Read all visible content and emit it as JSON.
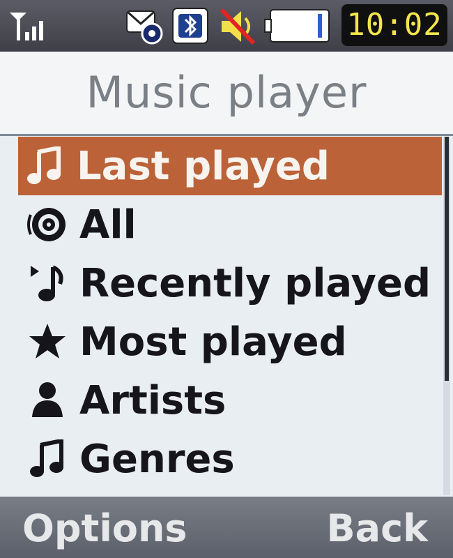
{
  "status_bar": {
    "icons": [
      "signal-icon",
      "mms-icon",
      "bluetooth-icon",
      "mute-icon",
      "battery-icon"
    ],
    "time": "10:02"
  },
  "header": {
    "title": "Music player"
  },
  "menu": {
    "items": [
      {
        "label": "Last played",
        "icon": "music-note-icon",
        "selected": true
      },
      {
        "label": "All",
        "icon": "disc-icon",
        "selected": false
      },
      {
        "label": "Recently played",
        "icon": "recent-note-icon",
        "selected": false
      },
      {
        "label": "Most played",
        "icon": "star-icon",
        "selected": false
      },
      {
        "label": "Artists",
        "icon": "person-icon",
        "selected": false
      },
      {
        "label": "Genres",
        "icon": "music-note-icon",
        "selected": false
      }
    ]
  },
  "softkeys": {
    "left_label": "Options",
    "right_label": "Back"
  },
  "colors": {
    "selection": "#bb6238",
    "clock_text": "#f3e64a",
    "list_background": "#e9eef2"
  }
}
